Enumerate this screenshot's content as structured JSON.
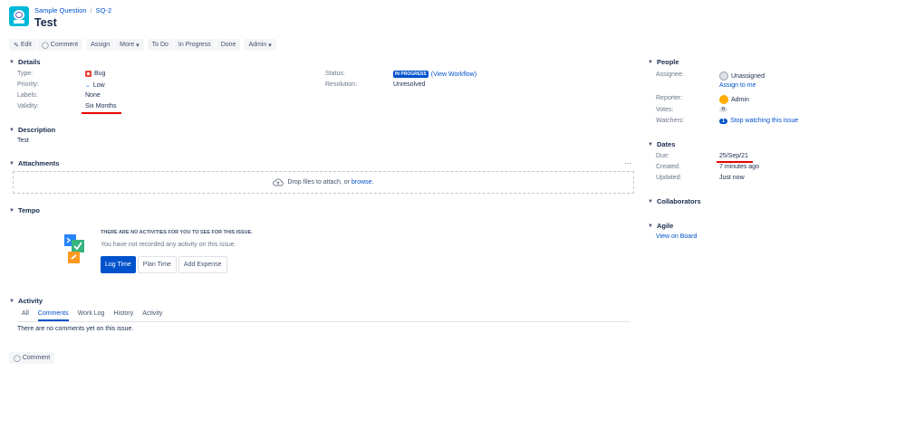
{
  "breadcrumb": {
    "project": "Sample Question",
    "separator": "/",
    "issue_key": "SQ-2"
  },
  "issue_title": "Test",
  "toolbar": {
    "edit": "Edit",
    "comment": "Comment",
    "assign": "Assign",
    "more": "More",
    "todo": "To Do",
    "in_progress": "In Progress",
    "done": "Done",
    "admin": "Admin"
  },
  "details": {
    "heading": "Details",
    "type_label": "Type:",
    "type_value": "Bug",
    "priority_label": "Priority:",
    "priority_value": "Low",
    "labels_label": "Labels:",
    "labels_value": "None",
    "validity_label": "Validity:",
    "validity_value": "Six Months",
    "status_label": "Status:",
    "status_value": "IN PROGRESS",
    "status_link": "(View Workflow)",
    "resolution_label": "Resolution:",
    "resolution_value": "Unresolved"
  },
  "description": {
    "heading": "Description",
    "text": "Test"
  },
  "attachments": {
    "heading": "Attachments",
    "more": "···",
    "drop_text": "Drop files to attach, or",
    "browse": "browse",
    "period": "."
  },
  "tempo": {
    "heading": "Tempo",
    "empty_title": "THERE ARE NO ACTIVITIES FOR YOU TO SEE FOR THIS ISSUE.",
    "empty_sub": "You have not recorded any activity on this issue.",
    "log_time": "Log Time",
    "plan_time": "Plan Time",
    "add_expense": "Add Expense"
  },
  "activity": {
    "heading": "Activity",
    "tabs": [
      "All",
      "Comments",
      "Work Log",
      "History",
      "Activity"
    ],
    "empty": "There are no comments yet on this issue.",
    "comment_button": "Comment"
  },
  "people": {
    "heading": "People",
    "assignee_label": "Assignee:",
    "assignee_value": "Unassigned",
    "assign_to_me": "Assign to me",
    "reporter_label": "Reporter:",
    "reporter_value": "Admin",
    "votes_label": "Votes:",
    "votes_value": "0",
    "watchers_label": "Watchers:",
    "watchers_count": "1",
    "watchers_link": "Stop watching this issue"
  },
  "dates": {
    "heading": "Dates",
    "due_label": "Due:",
    "due_value": "25/Sep/21",
    "created_label": "Created:",
    "created_value": "7 minutes ago",
    "updated_label": "Updated:",
    "updated_value": "Just now"
  },
  "collaborators": {
    "heading": "Collaborators"
  },
  "agile": {
    "heading": "Agile",
    "link": "View on Board"
  }
}
